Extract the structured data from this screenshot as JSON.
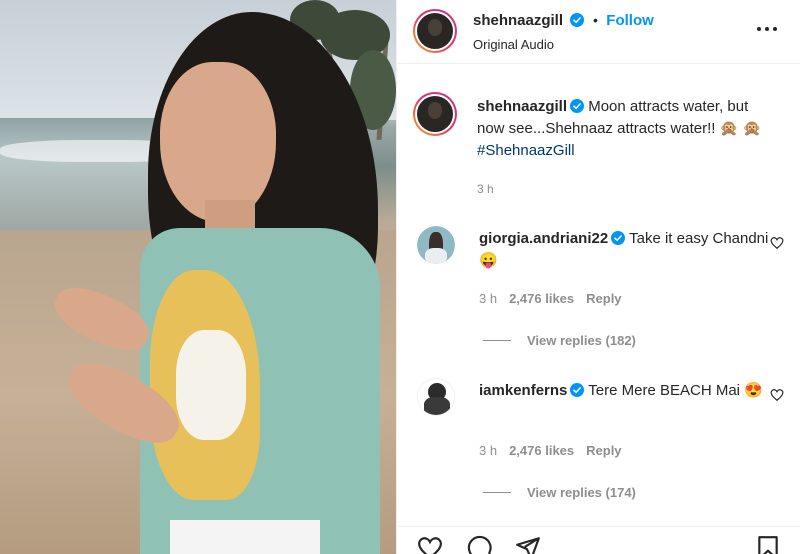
{
  "post": {
    "username": "shehnaazgill",
    "follow_label": "Follow",
    "audio_label": "Original Audio",
    "caption_user": "shehnaazgill",
    "caption_text": "Moon attracts water, but now see...Shehnaaz attracts water!! 🙊 🙊",
    "caption_hashtag": "#ShehnaazGill",
    "caption_time": "3 h"
  },
  "comments": [
    {
      "username": "giorgia.andriani22",
      "text": "Take it easy Chandni 😛",
      "time": "3 h",
      "likes": "2,476 likes",
      "reply_label": "Reply",
      "view_replies": "View replies (182)"
    },
    {
      "username": "iamkenferns",
      "text": "Tere Mere BEACH Mai 😍",
      "time": "3 h",
      "likes": "2,476 likes",
      "reply_label": "Reply",
      "view_replies": "View replies (174)"
    }
  ],
  "icons": {
    "verified": "verified-badge-icon",
    "more": "more-options-icon",
    "like": "heart-icon",
    "comment": "comment-icon",
    "share": "share-icon",
    "save": "bookmark-icon"
  },
  "colors": {
    "link_blue": "#0095f6",
    "hashtag": "#00376b",
    "muted": "#8e8e8e"
  }
}
